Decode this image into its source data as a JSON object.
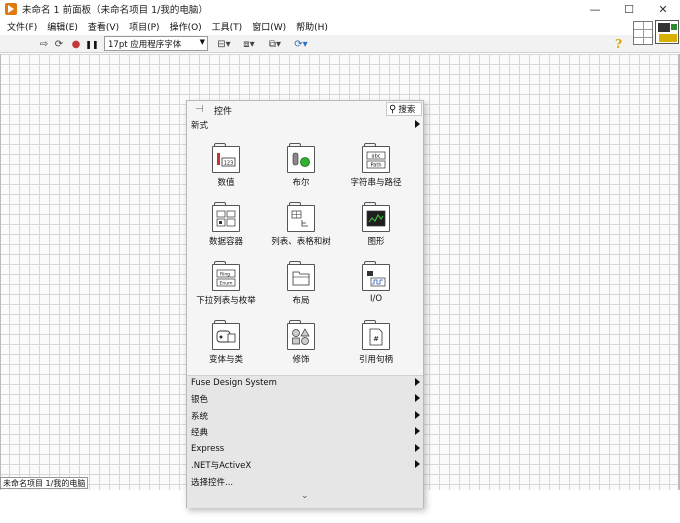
{
  "window": {
    "title": "未命名 1 前面板（未命名项目 1/我的电脑）",
    "minimize": "—",
    "maximize": "☐",
    "close": "✕"
  },
  "menu": [
    "文件(F)",
    "编辑(E)",
    "查看(V)",
    "项目(P)",
    "操作(O)",
    "工具(T)",
    "窗口(W)",
    "帮助(H)"
  ],
  "toolbar": {
    "run_icon": "⇨",
    "run_continuous_icon": "⟳",
    "abort_icon": "●",
    "pause_icon": "❚❚",
    "font_value": "17pt 应用程序字体",
    "font_arrow": "▼",
    "align_icon": "⊟▾",
    "distribute_icon": "⧈▾",
    "resize_icon": "⧉▾",
    "reorder_icon": "⟳▾",
    "help_glyph": "?"
  },
  "status": {
    "project_tag": "未命名项目 1/我的电脑"
  },
  "palette": {
    "title": "控件",
    "pin_glyph": "⊣",
    "search_label": "搜索",
    "search_glyph": "🔍",
    "subpalette_header": "新式",
    "items": [
      {
        "label": "数值",
        "icon": "numeric-icon",
        "glyph": "123"
      },
      {
        "label": "布尔",
        "icon": "boolean-icon",
        "glyph": ""
      },
      {
        "label": "字符串与路径",
        "icon": "string-path-icon",
        "glyph": "abc"
      },
      {
        "label": "数据容器",
        "icon": "data-container-icon",
        "glyph": ""
      },
      {
        "label": "列表、表格和树",
        "icon": "list-table-tree-icon",
        "glyph": ""
      },
      {
        "label": "图形",
        "icon": "graph-icon",
        "glyph": ""
      },
      {
        "label": "下拉列表与枚举",
        "icon": "ring-enum-icon",
        "glyph": "Ring"
      },
      {
        "label": "布局",
        "icon": "layout-icon",
        "glyph": ""
      },
      {
        "label": "I/O",
        "icon": "io-icon",
        "glyph": ""
      },
      {
        "label": "变体与类",
        "icon": "variant-class-icon",
        "glyph": ""
      },
      {
        "label": "修饰",
        "icon": "decorations-icon",
        "glyph": ""
      },
      {
        "label": "引用句柄",
        "icon": "refnum-icon",
        "glyph": "#"
      }
    ],
    "path_glyph": "Path",
    "enum_glyph": "Enum",
    "subpalettes": [
      "Fuse Design System",
      "银色",
      "系统",
      "经典",
      "Express",
      ".NET与ActiveX",
      "选择控件..."
    ],
    "more_glyph": "⌄"
  }
}
